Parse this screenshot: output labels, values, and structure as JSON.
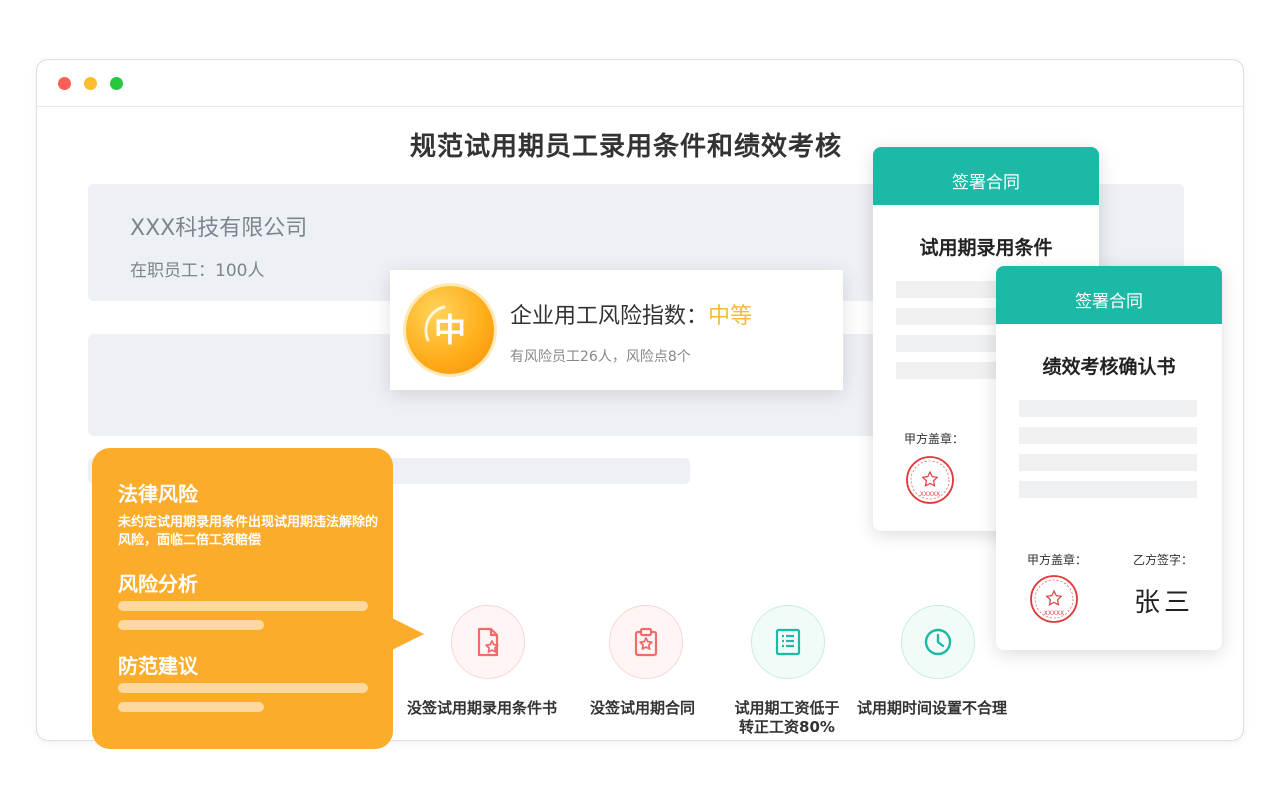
{
  "page": {
    "title": "规范试用期员工录用条件和绩效考核"
  },
  "company": {
    "name": "XXX科技有限公司",
    "staff": "在职员工：100人"
  },
  "risk_index": {
    "badge": "中",
    "label": "企业用工风险指数：",
    "level": "中等",
    "summary": "有风险员工26人，风险点8个",
    "level_color": "#fbb83f"
  },
  "risk_panel": {
    "legal_title": "法律风险",
    "legal_desc": "未约定试用期录用条件出现试用期违法解除的风险，面临二倍工资赔偿",
    "analysis_title": "风险分析",
    "advice_title": "防范建议"
  },
  "risk_items": [
    {
      "label": "没签试用期录用条件书",
      "icon": "document-star-icon",
      "color": "#f26b6b"
    },
    {
      "label": "没签试用期合同",
      "icon": "clipboard-star-icon",
      "color": "#f26b6b"
    },
    {
      "label": "试用期工资低于\n转正工资80%",
      "icon": "list-document-icon",
      "color": "#1cbaa6"
    },
    {
      "label": "试用期时间设置不合理",
      "icon": "clock-icon",
      "color": "#1cbaa6"
    }
  ],
  "contract_cards": [
    {
      "header": "签署合同",
      "title": "试用期录用条件",
      "party_a": "甲方盖章："
    },
    {
      "header": "签署合同",
      "title": "绩效考核确认书",
      "party_a": "甲方盖章：",
      "party_b": "乙方签字：",
      "signature": "张三"
    }
  ],
  "seal": {
    "text": "XXXXX",
    "color": "#e0393c"
  },
  "colors": {
    "accent_teal": "#1cbaa6",
    "accent_orange": "#fbac2a"
  }
}
